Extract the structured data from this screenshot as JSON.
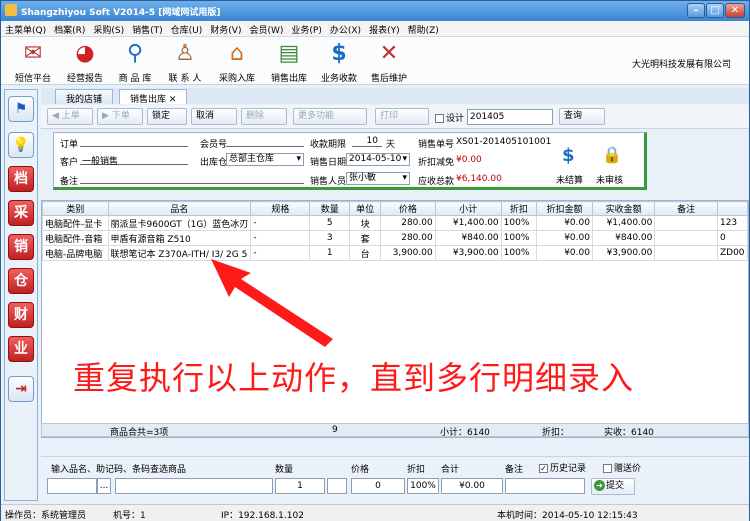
{
  "window": {
    "title": "Shangzhiyou Soft V2014-5 [网域网试用版]",
    "minimize": "–",
    "maximize": "□",
    "close": "✕"
  },
  "menu": [
    "主菜单(Q)",
    "档案(R)",
    "采购(S)",
    "销售(T)",
    "仓库(U)",
    "财务(V)",
    "会员(W)",
    "业务(P)",
    "办公(X)",
    "报表(Y)",
    "帮助(Z)"
  ],
  "toolbar": [
    {
      "label": "短信平台",
      "icon": "envelope-icon"
    },
    {
      "label": "经营报告",
      "icon": "chart-icon"
    },
    {
      "label": "商 品 库",
      "icon": "magnifier-icon"
    },
    {
      "label": "联 系 人",
      "icon": "person-icon"
    },
    {
      "label": "采购入库",
      "icon": "house-icon"
    },
    {
      "label": "销售出库",
      "icon": "clipboard-icon"
    },
    {
      "label": "业务收款",
      "icon": "dollar-icon"
    },
    {
      "label": "售后维护",
      "icon": "tools-icon"
    }
  ],
  "company": "大光明科技发展有限公司",
  "sidebar": [
    {
      "glyph": "⚑",
      "icon": "flag-icon"
    },
    {
      "glyph": "💡",
      "icon": "bulb-icon"
    },
    {
      "glyph": "档",
      "icon": "archive-icon"
    },
    {
      "glyph": "采",
      "icon": "purchase-icon"
    },
    {
      "glyph": "销",
      "icon": "sales-icon"
    },
    {
      "glyph": "仓",
      "icon": "warehouse-icon"
    },
    {
      "glyph": "财",
      "icon": "finance-icon"
    },
    {
      "glyph": "业",
      "icon": "business-icon"
    },
    {
      "glyph": "⇥",
      "icon": "exit-icon"
    }
  ],
  "tabs": [
    {
      "label": "我的店铺"
    },
    {
      "label": "销售出库",
      "close": "✕"
    }
  ],
  "actions": {
    "prev": "◀ 上单",
    "next": "▶ 下单",
    "confirm": "锁定",
    "cancel": "取消",
    "delete": "删除",
    "more": "更多功能",
    "print": "打印",
    "design_label": "设计",
    "period": "201405",
    "query": "查询"
  },
  "header": {
    "order_label": "订单",
    "order_value": "",
    "customer_label": "客户",
    "customer_value": "一般销售",
    "note_label": "备注",
    "note_value": "",
    "member_label": "会员号",
    "member_value": "",
    "warehouse_label": "出库仓",
    "warehouse_value": "总部主仓库",
    "term_label": "收款期限",
    "term_value": "10",
    "term_unit": "天",
    "date_label": "销售日期",
    "date_value": "2014-05-10",
    "staff_label": "销售人员",
    "staff_value": "张小敏",
    "docno_label": "销售单号",
    "docno_value": "XS01-201405101001",
    "discount_label": "折扣减免",
    "discount_value": "¥0.00",
    "receivable_label": "应收总款",
    "receivable_value": "¥6,140.00",
    "unsettled": "未结算",
    "unreviewed": "未审核"
  },
  "grid": {
    "columns": [
      "类别",
      "品名",
      "规格",
      "数量",
      "单位",
      "价格",
      "小计",
      "折扣",
      "折扣金额",
      "实收金额",
      "备注",
      ""
    ],
    "rows": [
      [
        "电脑配件-显卡",
        "丽派显卡9600GT（1G）蓝色冰刃",
        "-",
        "5",
        "块",
        "280.00",
        "¥1,400.00",
        "100%",
        "¥0.00",
        "¥1,400.00",
        "",
        "123"
      ],
      [
        "电脑配件-音箱",
        "甲盾有源音箱 Z510",
        "-",
        "3",
        "套",
        "280.00",
        "¥840.00",
        "100%",
        "¥0.00",
        "¥840.00",
        "",
        "0"
      ],
      [
        "电脑-品牌电脑",
        "联想笔记本 Z370A-ITH/ I3/ 2G 5",
        "-",
        "1",
        "台",
        "3,900.00",
        "¥3,900.00",
        "100%",
        "¥0.00",
        "¥3,900.00",
        "",
        "ZD00"
      ]
    ],
    "footer": {
      "count": "商品合共=3项",
      "qty": "9",
      "subtotal": "小计：6140",
      "discount": "折扣：",
      "received": "实收：6140"
    }
  },
  "annotation": "重复执行以上动作，直到多行明细录入",
  "entry": {
    "name_label": "输入品名、助记码、条码查选商品",
    "browse": "...",
    "qty_label": "数量",
    "qty_value": "1",
    "price_label": "价格",
    "price_value": "0",
    "discount_label": "折扣",
    "discount_value": "100%",
    "total_label": "合计",
    "total_value": "¥0.00",
    "note_label": "备注",
    "history_label": "历史记录",
    "history_checked": "✓",
    "giveaway_label": "赠送价",
    "submit": "提交"
  },
  "status": {
    "operator": "操作员：系统管理员",
    "machine": "机号：1",
    "ip": "IP：192.168.1.102",
    "time": "本机时间：2014-05-10 12:15:43"
  },
  "colors": {
    "accent": "#3a85d0",
    "annotation": "#ff1a1a",
    "header_border": "#3a9a3a"
  }
}
